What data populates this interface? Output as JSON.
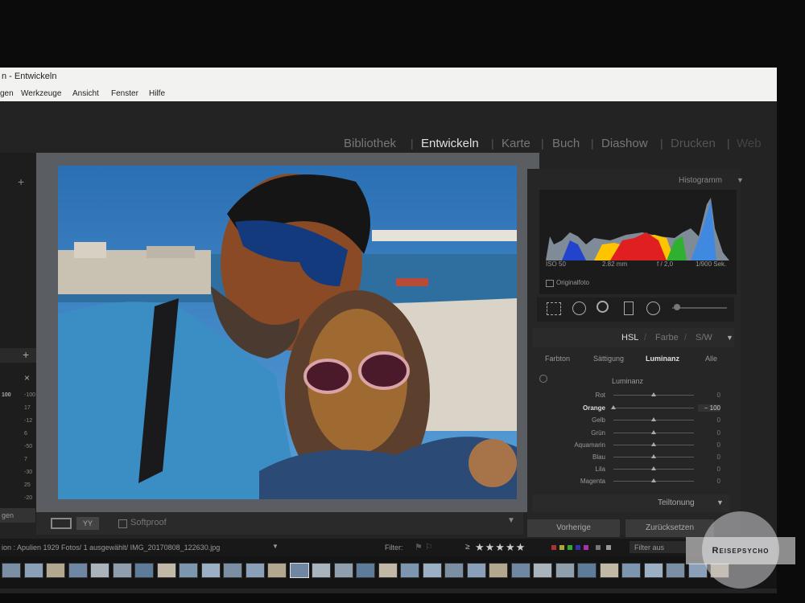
{
  "window": {
    "title": "n - Entwickeln",
    "minimize": "—",
    "maximize": "❐",
    "close": "✕"
  },
  "menu": [
    "gen",
    "Werkzeuge",
    "Ansicht",
    "Fenster",
    "Hilfe"
  ],
  "modules": {
    "items": [
      "Bibliothek",
      "Entwickeln",
      "Karte",
      "Buch",
      "Diashow",
      "Drucken",
      "Web"
    ],
    "active": "Entwickeln"
  },
  "left_panel": {
    "plus_top": "+",
    "plus_mid": "+",
    "close": "×",
    "numbers": [
      [
        "100",
        "-100"
      ],
      [
        "",
        "17"
      ],
      [
        "",
        "-12"
      ],
      [
        "",
        "6"
      ],
      [
        "",
        "-50"
      ],
      [
        "",
        "7"
      ],
      [
        "",
        "-30"
      ],
      [
        "",
        "25"
      ],
      [
        "",
        "-20"
      ]
    ],
    "bottom_button": "gen"
  },
  "histogram": {
    "title": "Histogramm",
    "iso": "ISO 50",
    "focal": "2.82 mm",
    "aperture": "f / 2,0",
    "shutter": "1/900 Sek.",
    "original_label": "Originalfoto"
  },
  "hsl": {
    "header": [
      "HSL",
      "Farbe",
      "S/W"
    ],
    "subtabs": [
      "Farbton",
      "Sättigung",
      "Luminanz",
      "Alle"
    ],
    "active_subtab": "Luminanz",
    "section_title": "Luminanz",
    "sliders": [
      {
        "label": "Rot",
        "value": "0",
        "level": 0
      },
      {
        "label": "Orange",
        "value": "− 100",
        "level": -100,
        "active": true
      },
      {
        "label": "Gelb",
        "value": "0",
        "level": 0
      },
      {
        "label": "Grün",
        "value": "0",
        "level": 0
      },
      {
        "label": "Aquamarin",
        "value": "0",
        "level": 0
      },
      {
        "label": "Blau",
        "value": "0",
        "level": 0
      },
      {
        "label": "Lila",
        "value": "0",
        "level": 0
      },
      {
        "label": "Magenta",
        "value": "0",
        "level": 0
      }
    ]
  },
  "split_toning": "Teiltonung",
  "buttons": {
    "previous": "Vorherige",
    "reset": "Zurücksetzen"
  },
  "toolbar": {
    "softproof": "Softproof",
    "yy": "YY"
  },
  "filmstrip": {
    "info": "ion : Apulien   1929 Fotos/ 1 ausgewählt/ IMG_20170808_122630.jpg",
    "filter_label": "Filter:",
    "stars_prefix": "≥",
    "stars": "★★★★★",
    "filter_value": "Filter aus"
  },
  "watermark": "Reisepsycho",
  "colors": {
    "accent_active": "#e0e0e0",
    "panel_bg": "#262627",
    "sky": "#2f74b5"
  }
}
